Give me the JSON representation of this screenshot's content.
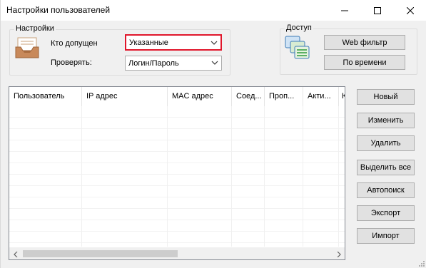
{
  "window": {
    "title": "Настройки пользователей"
  },
  "settings": {
    "group_title": "Настройки",
    "allowed_label": "Кто допущен",
    "allowed_value": "Указанные",
    "check_label": "Проверять:",
    "check_value": "Логин/Пароль"
  },
  "access": {
    "group_title": "Доступ",
    "web_filter_label": "Web фильтр",
    "by_time_label": "По времени"
  },
  "user_list": {
    "columns": [
      "Пользователь",
      "IP адрес",
      "MAC адрес",
      "Соед...",
      "Проп...",
      "Акти...",
      "К"
    ]
  },
  "actions": {
    "new_label": "Новый",
    "edit_label": "Изменить",
    "delete_label": "Удалить",
    "select_all_label": "Выделить все",
    "autosearch_label": "Автопоиск",
    "export_label": "Экспорт",
    "import_label": "Импорт"
  },
  "colors": {
    "highlight_border": "#e0162b",
    "button_bg": "#e1e1e1",
    "window_bg": "#f0f0f0"
  }
}
